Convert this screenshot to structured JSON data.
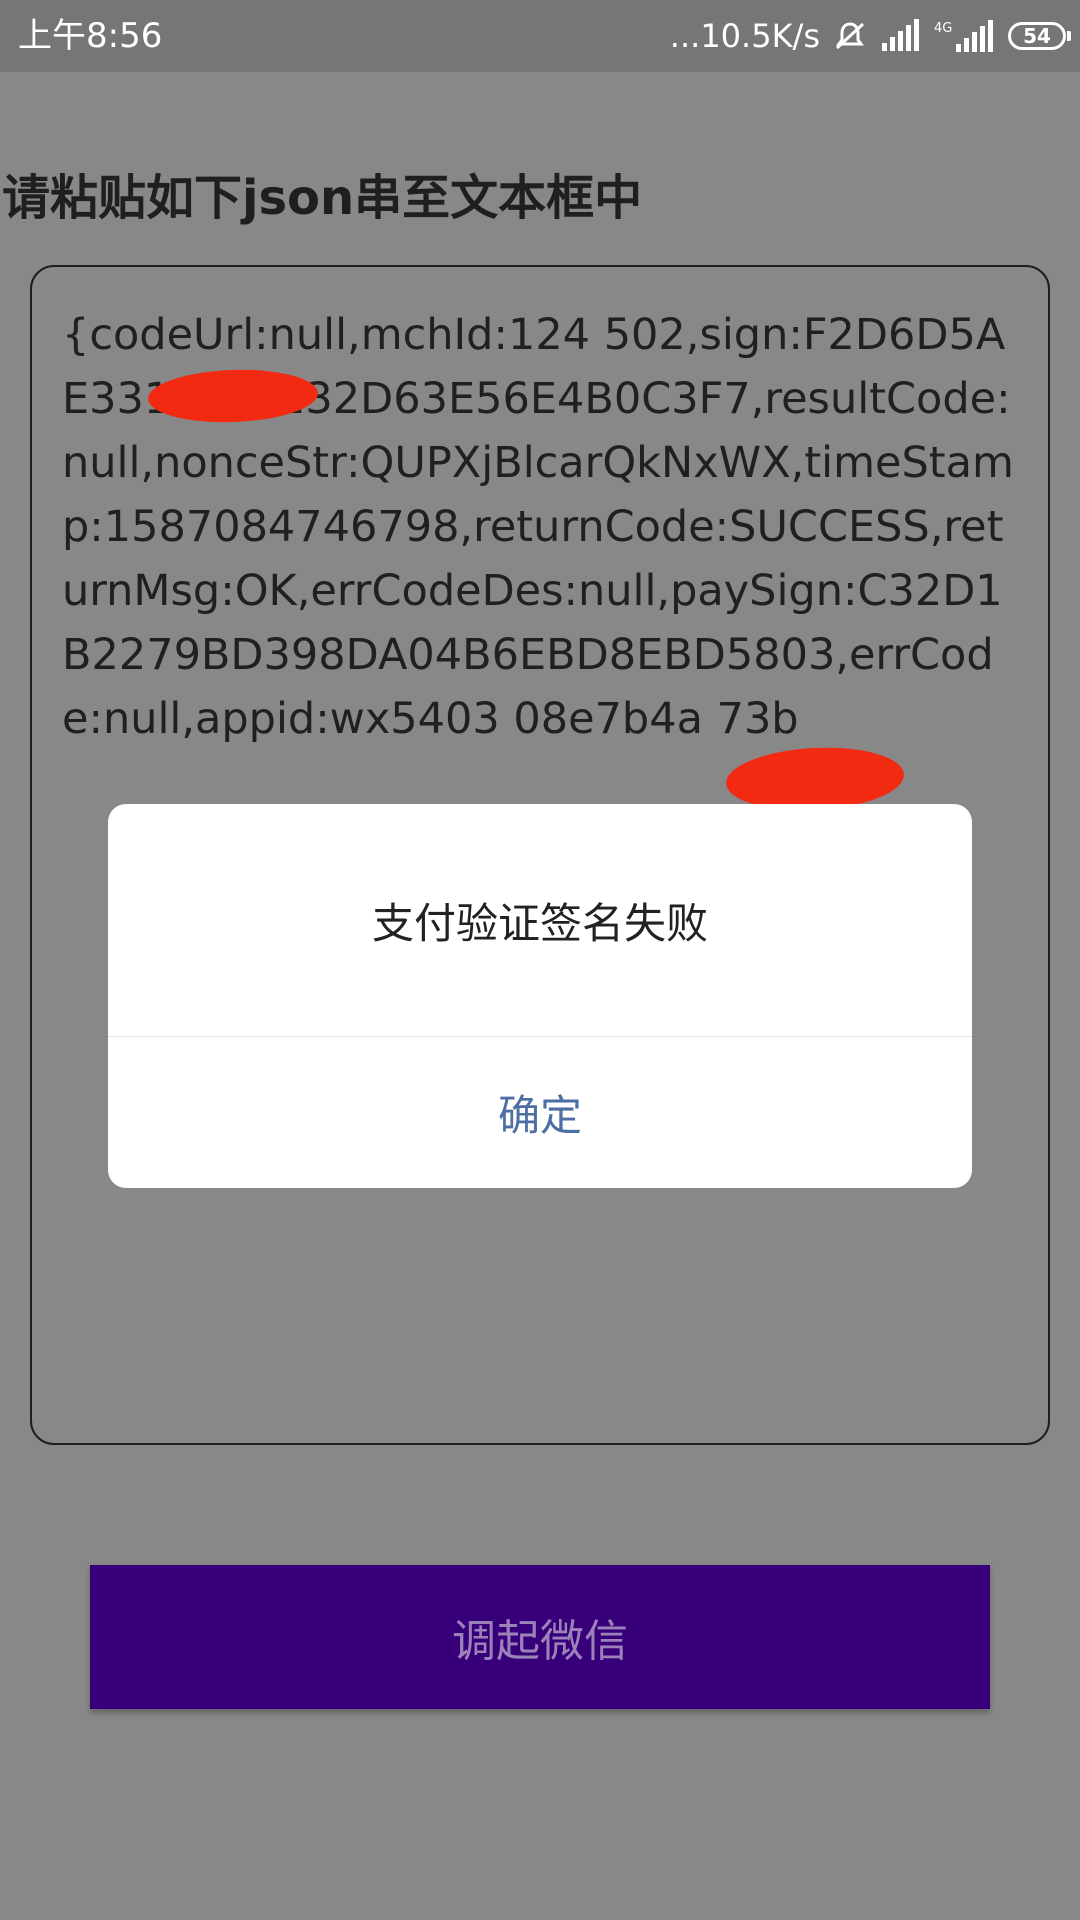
{
  "status_bar": {
    "time": "上午8:56",
    "net_speed": "...10.5K/s",
    "network_label": "4G",
    "battery_level": "54",
    "icons": [
      "mute-icon",
      "signal-icon",
      "signal-4g-icon",
      "battery-icon"
    ]
  },
  "page": {
    "title": "请粘贴如下json串至文本框中",
    "text_box_content": "{codeUrl:null,mchId:124      502,sign:F2D6D5AE3318F81132D63E56E4B0C3F7,resultCode:null,nonceStr:QUPXjBlcarQkNxWX,timeStamp:1587084746798,returnCode:SUCCESS,returnMsg:OK,errCodeDes:null,paySign:C32D1B2279BD398DA04B6EBD8EBD5803,errCode:null,appid:wx5403      08e7b4a                                   73b",
    "button_label": "调起微信"
  },
  "dialog": {
    "message": "支付验证签名失败",
    "confirm_label": "确定"
  },
  "colors": {
    "overlay_background": "#888888",
    "button_background": "#37007a",
    "button_text": "#9b82b8",
    "dialog_confirm_text": "#4c6ea3",
    "redaction": "#f22a12"
  }
}
